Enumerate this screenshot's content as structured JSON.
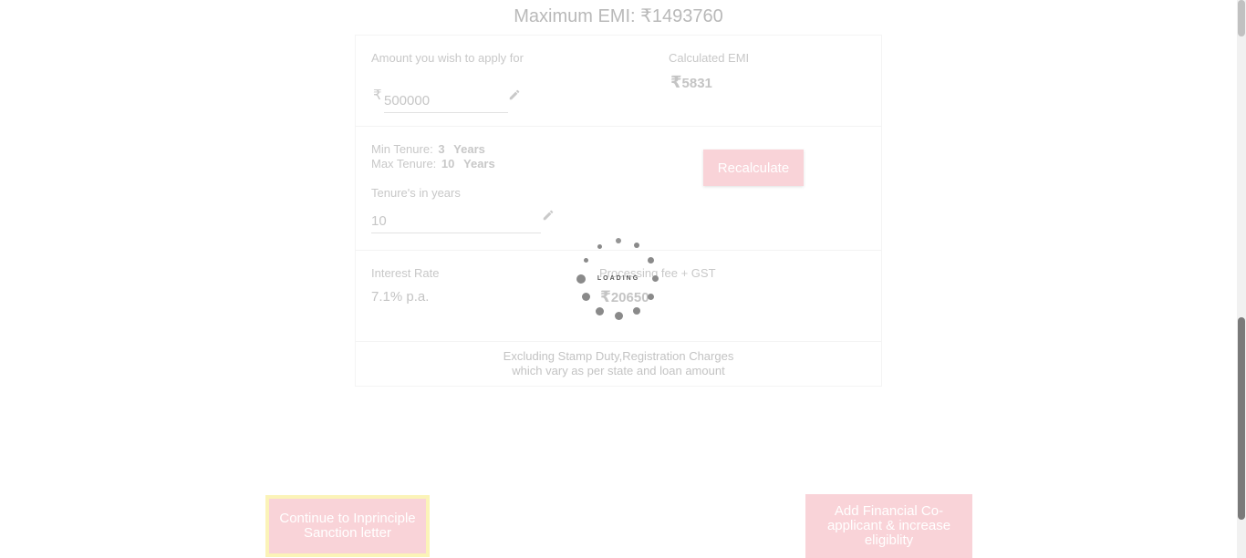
{
  "header": {
    "max_emi_label": "Maximum EMI:",
    "currency": "₹",
    "max_emi_value": "1493760"
  },
  "loan": {
    "amount_label": "Amount you wish to apply for",
    "amount_currency": "₹",
    "amount_value": "500000",
    "emi_label": "Calculated EMI",
    "emi_currency": "₹",
    "emi_value": "5831"
  },
  "tenure": {
    "min_label": "Min Tenure:",
    "min_value": "3",
    "max_label": "Max Tenure:",
    "max_value": "10",
    "unit": "Years",
    "input_label": "Tenure's in years",
    "input_value": "10",
    "recalculate_label": "Recalculate"
  },
  "rates": {
    "interest_label": "Interest Rate",
    "interest_value": "7.1% p.a.",
    "fee_label": "Processing fee + GST",
    "fee_currency": "₹",
    "fee_value": "20650"
  },
  "note": {
    "line1": "Excluding Stamp Duty,Registration Charges",
    "line2": "which vary as per state and loan amount"
  },
  "loading_text": "LOADING",
  "buttons": {
    "continue_label": "Continue to Inprinciple Sanction letter",
    "add_label": "Add Financial Co-applicant & increase eligiblity"
  },
  "colors": {
    "accent_pink": "#f9d3d8",
    "highlight_yellow": "#fbf3b8"
  },
  "icons": {
    "edit": "pencil-icon"
  }
}
